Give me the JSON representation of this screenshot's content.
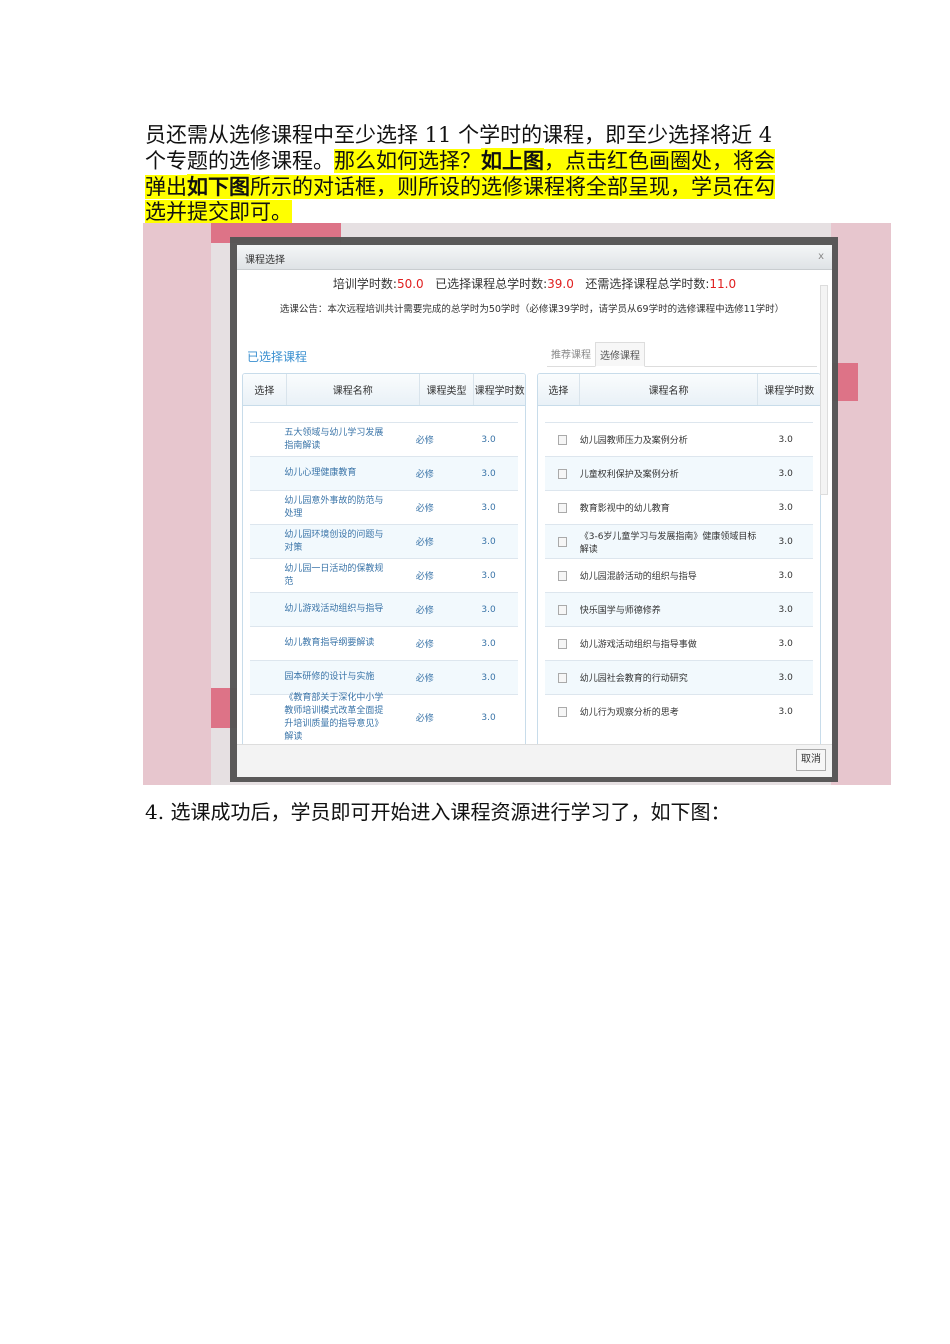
{
  "paragraph": {
    "l1": "员还需从选修课程中至少选择 11 个学时的课程，即至少选择将近 4",
    "l2a": "个专题的选修课程。",
    "l2b": "那么如何选择？",
    "l2c": "如上图",
    "l2d": "，点击红色画圈处，将会",
    "l3a": "弹出",
    "l3b": "如下图",
    "l3c": "所示的对话框，则所设的选修课程将全部呈现，学员在勾",
    "l4": "选并提交即可。"
  },
  "dialog": {
    "title": "课程选择",
    "close": "x",
    "stats": {
      "train_label": "培训学时数:",
      "train_value": "50.0",
      "selected_label": "已选择课程总学时数:",
      "selected_value": "39.0",
      "need_label": "还需选择课程总学时数:",
      "need_value": "11.0"
    },
    "notice": "选课公告：本次远程培训共计需要完成的总学时为50学时（必修课39学时，请学员从69学时的选修课程中选修11学时）",
    "selected_heading": "已选择课程",
    "tabs": [
      "推荐课程",
      "选修课程"
    ],
    "left_headers": [
      "选择",
      "课程名称",
      "课程类型",
      "课程学时数"
    ],
    "left_rows": [
      {
        "name": "五大领域与幼儿学习发展指南解读",
        "type": "必修",
        "hours": "3.0"
      },
      {
        "name": "幼儿心理健康教育",
        "type": "必修",
        "hours": "3.0"
      },
      {
        "name": "幼儿园意外事故的防范与处理",
        "type": "必修",
        "hours": "3.0"
      },
      {
        "name": "幼儿园环境创设的问题与对策",
        "type": "必修",
        "hours": "3.0"
      },
      {
        "name": "幼儿园一日活动的保教规范",
        "type": "必修",
        "hours": "3.0"
      },
      {
        "name": "幼儿游戏活动组织与指导",
        "type": "必修",
        "hours": "3.0"
      },
      {
        "name": "幼儿教育指导纲要解读",
        "type": "必修",
        "hours": "3.0"
      },
      {
        "name": "园本研修的设计与实施",
        "type": "必修",
        "hours": "3.0"
      },
      {
        "name": "《教育部关于深化中小学教师培训模式改革全面提升培训质量的指导意见》解读",
        "type": "必修",
        "hours": "3.0"
      }
    ],
    "right_headers": [
      "选择",
      "课程名称",
      "课程学时数"
    ],
    "right_rows": [
      {
        "name": "幼儿园教师压力及案例分析",
        "hours": "3.0"
      },
      {
        "name": "儿童权利保护及案例分析",
        "hours": "3.0"
      },
      {
        "name": "教育影视中的幼儿教育",
        "hours": "3.0"
      },
      {
        "name": "《3-6岁儿童学习与发展指南》健康领域目标解读",
        "hours": "3.0"
      },
      {
        "name": "幼儿园混龄活动的组织与指导",
        "hours": "3.0"
      },
      {
        "name": "快乐国学与师德修养",
        "hours": "3.0"
      },
      {
        "name": "幼儿游戏活动组织与指导事做",
        "hours": "3.0"
      },
      {
        "name": "幼儿园社会教育的行动研究",
        "hours": "3.0"
      },
      {
        "name": "幼儿行为观察分析的思考",
        "hours": "3.0"
      }
    ],
    "cancel": "取消"
  },
  "step": "4.   选课成功后，学员即可开始进入课程资源进行学习了，如下图："
}
